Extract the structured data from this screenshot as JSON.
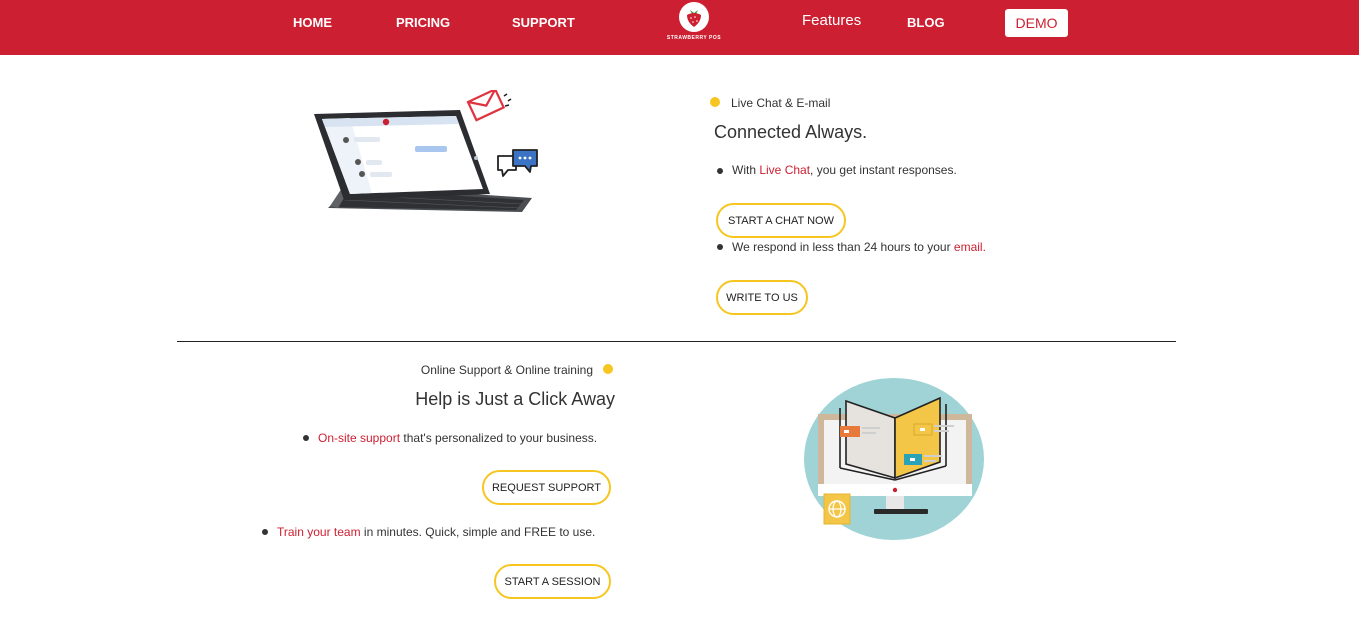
{
  "nav": {
    "home": "HOME",
    "pricing": "PRICING",
    "support": "SUPPORT",
    "logo_text": "STRAWBERRY POS",
    "features": "Features",
    "blog": "BLOG",
    "demo": "DEMO"
  },
  "section1": {
    "eyebrow": "Live Chat & E-mail",
    "heading": "Connected Always.",
    "item1": {
      "pre": "With ",
      "link": "Live Chat",
      "post": ", you get instant responses."
    },
    "button1": "START A CHAT NOW",
    "item2": {
      "pre": "We respond in less than 24 hours to your ",
      "link": "email."
    },
    "button2": "WRITE TO US"
  },
  "section2": {
    "eyebrow": "Online Support & Online training",
    "heading": "Help is Just a Click Away",
    "item1": {
      "link": "On-site support",
      "post": " that's personalized to your business."
    },
    "button1": "REQUEST SUPPORT",
    "item2": {
      "link": "Train your team",
      "post": " in minutes. Quick, simple and FREE to use."
    },
    "button2": "START A SESSION"
  },
  "colors": {
    "brand_red": "#cc1f31",
    "accent_yellow": "#f7c520",
    "text": "#333333"
  },
  "icons": {
    "logo": "strawberry-icon",
    "envelope": "envelope-icon",
    "chat": "chat-bubbles-icon",
    "tablet": "tablet-illustration",
    "monitor": "monitor-book-illustration"
  }
}
